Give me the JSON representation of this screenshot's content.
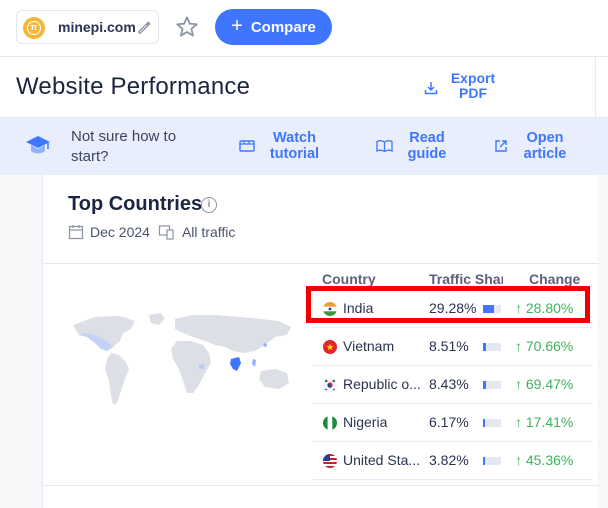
{
  "topbar": {
    "site_name": "minepi.com",
    "compare_label": "Compare"
  },
  "header": {
    "title": "Website Performance",
    "export_label_1": "Export",
    "export_label_2": "PDF"
  },
  "banner": {
    "question_1": "Not sure how to",
    "question_2": "start?",
    "links": [
      {
        "line1": "Watch",
        "line2": "tutorial",
        "icon": "video-icon"
      },
      {
        "line1": "Read",
        "line2": "guide",
        "icon": "book-icon"
      },
      {
        "line1": "Open",
        "line2": "article",
        "icon": "external-link-icon"
      }
    ]
  },
  "card": {
    "title": "Top Countries",
    "date": "Dec 2024",
    "traffic_type": "All traffic",
    "columns": [
      "Country",
      "Traffic Shar",
      "Change"
    ],
    "rows": [
      {
        "country": "India",
        "share": "29.28%",
        "share_value": 29.28,
        "change": "28.80%"
      },
      {
        "country": "Vietnam",
        "share": "8.51%",
        "share_value": 8.51,
        "change": "70.66%"
      },
      {
        "country": "Republic o...",
        "share": "8.43%",
        "share_value": 8.43,
        "change": "69.47%"
      },
      {
        "country": "Nigeria",
        "share": "6.17%",
        "share_value": 6.17,
        "change": "17.41%"
      },
      {
        "country": "United Sta...",
        "share": "3.82%",
        "share_value": 3.82,
        "change": "45.36%"
      }
    ]
  },
  "colors": {
    "accent": "#3f76ff",
    "positive": "#3db35a",
    "highlight": "#f10000"
  }
}
